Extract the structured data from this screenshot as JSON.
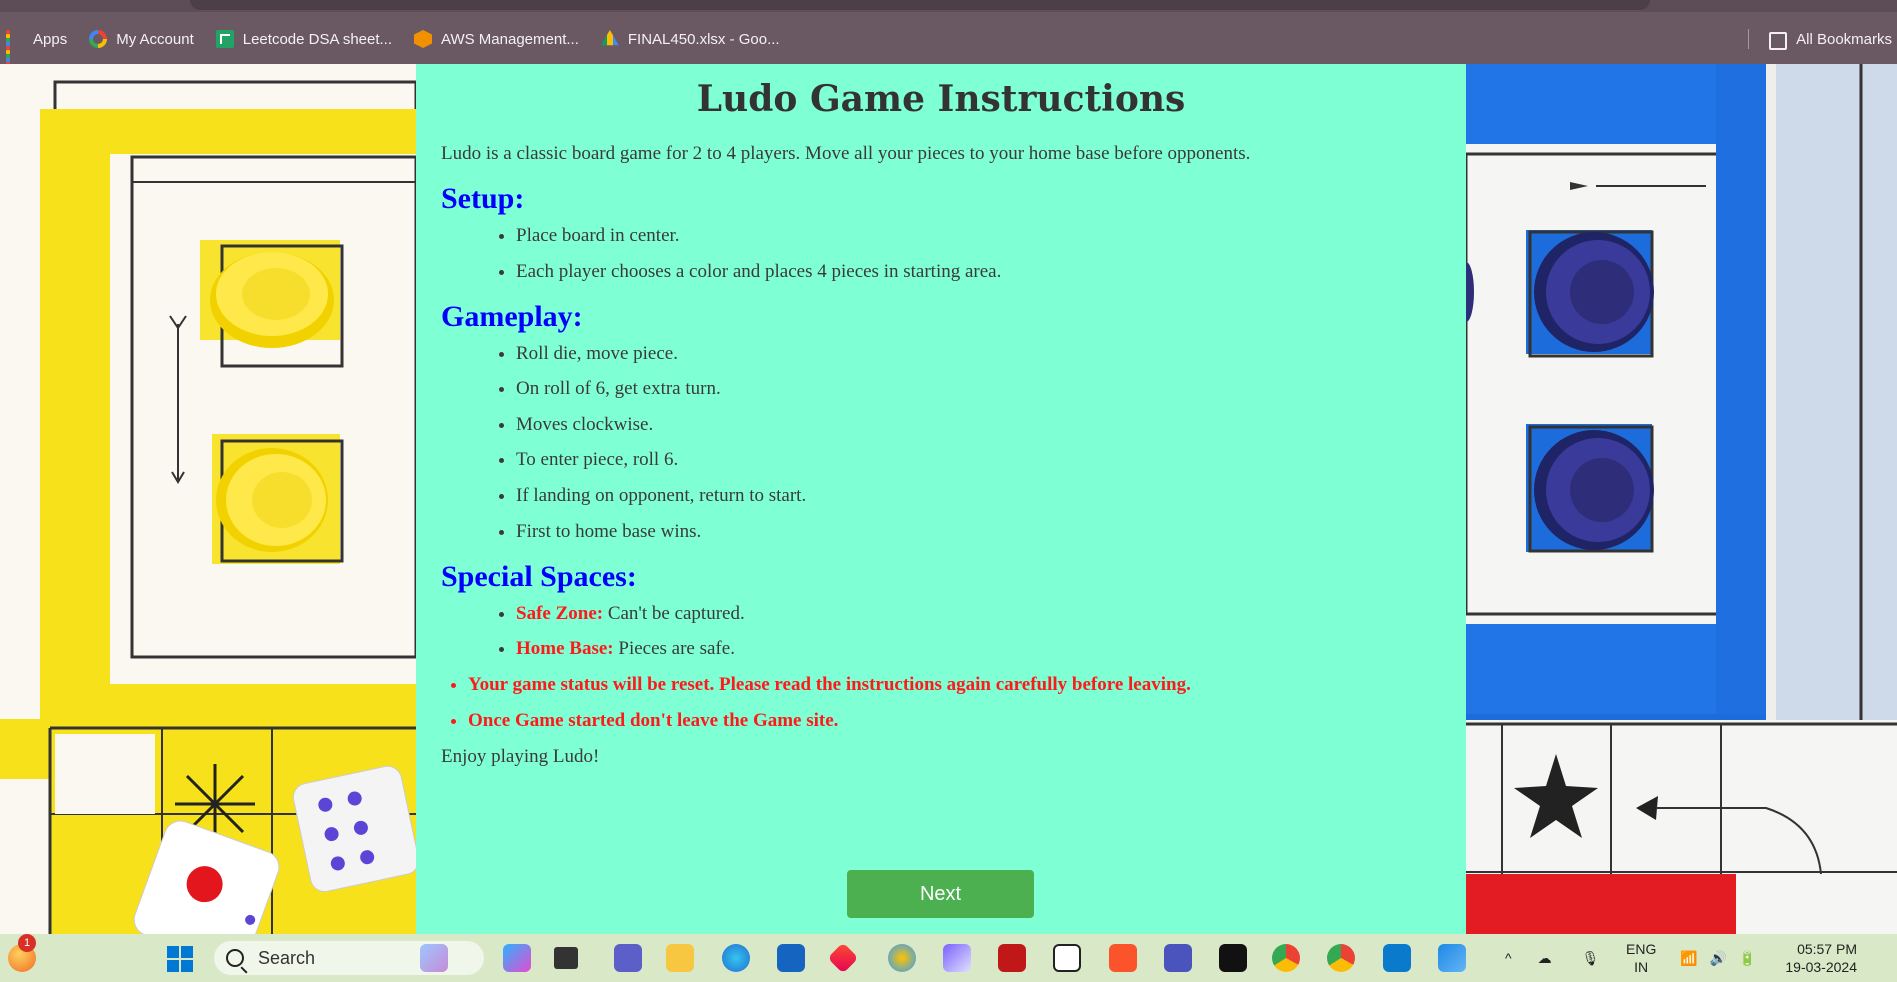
{
  "bookmarks_bar": {
    "items": [
      {
        "label": "Apps",
        "icon": "apps-grid-icon"
      },
      {
        "label": "My Account",
        "icon": "google-icon"
      },
      {
        "label": "Leetcode DSA sheet...",
        "icon": "google-sheets-icon"
      },
      {
        "label": "AWS Management...",
        "icon": "aws-icon"
      },
      {
        "label": "FINAL450.xlsx - Goo...",
        "icon": "google-drive-icon"
      }
    ],
    "all_bookmarks": "All Bookmarks"
  },
  "page": {
    "title": "Ludo Game Instructions",
    "intro": "Ludo is a classic board game for 2 to 4 players. Move all your pieces to your home base before opponents.",
    "sections": {
      "setup": {
        "heading": "Setup:",
        "items": [
          "Place board in center.",
          "Each player chooses a color and places 4 pieces in starting area."
        ]
      },
      "gameplay": {
        "heading": "Gameplay:",
        "items": [
          "Roll die, move piece.",
          "On roll of 6, get extra turn.",
          "Moves clockwise.",
          "To enter piece, roll 6.",
          "If landing on opponent, return to start.",
          "First to home base wins."
        ]
      },
      "special": {
        "heading": "Special Spaces:",
        "items": [
          {
            "term": "Safe Zone:",
            "text": " Can't be captured."
          },
          {
            "term": "Home Base:",
            "text": " Pieces are safe."
          }
        ]
      }
    },
    "warnings": [
      "Your game status will be reset. Please read the instructions again carefully before leaving.",
      "Once Game started don't leave the Game site."
    ],
    "outro": "Enjoy playing Ludo!",
    "next_button": "Next",
    "colors": {
      "content_bg": "#7fffd4",
      "heading_blue": "#0000ff",
      "warning_red": "#ff1a1a",
      "button_green": "#4caf50"
    }
  },
  "taskbar": {
    "notification_count": "1",
    "search_label": "Search",
    "language": "ENG",
    "region": "IN",
    "time": "05:57 PM",
    "date": "19-03-2024",
    "apps": [
      "file-explorer-icon",
      "copilot-icon",
      "task-view-icon",
      "teams-icon",
      "folder-icon",
      "edge-icon",
      "store-icon",
      "office-icon",
      "paint-icon",
      "copilot-pro-icon",
      "mcafee-icon",
      "notion-icon",
      "brave-icon",
      "teams-work-icon",
      "app-icon",
      "chrome-icon",
      "chrome-profile-icon",
      "vscode-icon",
      "photos-icon"
    ]
  }
}
